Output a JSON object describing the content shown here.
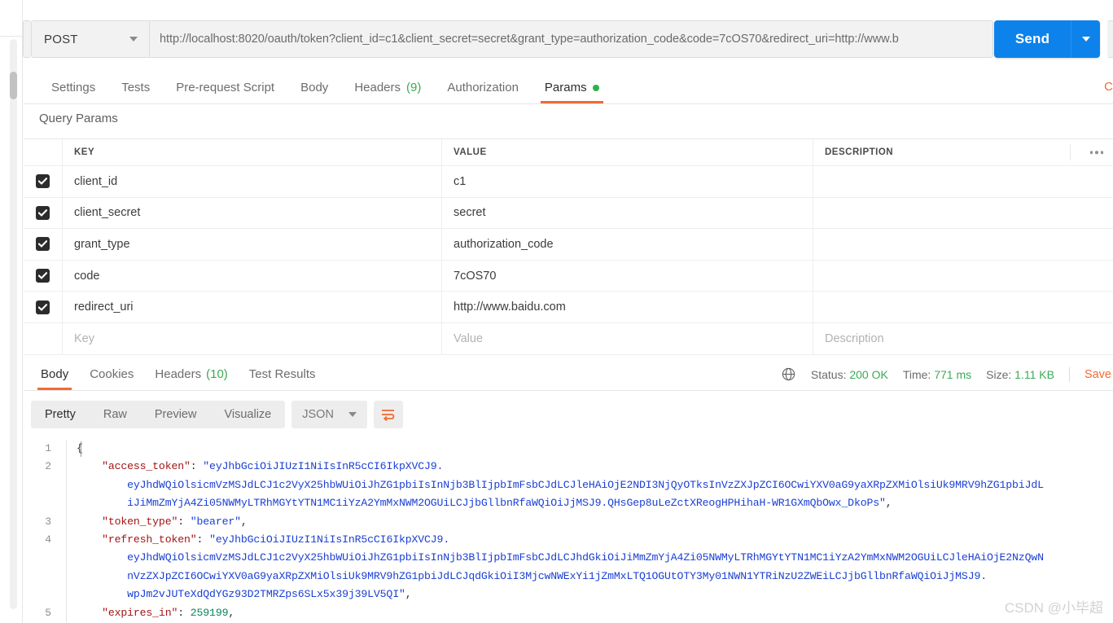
{
  "request": {
    "method": "POST",
    "url": "http://localhost:8020/oauth/token?client_id=c1&client_secret=secret&grant_type=authorization_code&code=7cOS70&redirect_uri=http://www.b",
    "send_label": "Send",
    "tabs": [
      {
        "label": "Params",
        "badge": "",
        "dot": true,
        "active": true
      },
      {
        "label": "Authorization",
        "badge": "",
        "dot": false,
        "active": false
      },
      {
        "label": "Headers",
        "badge": "(9)",
        "dot": false,
        "active": false
      },
      {
        "label": "Body",
        "badge": "",
        "dot": false,
        "active": false
      },
      {
        "label": "Pre-request Script",
        "badge": "",
        "dot": false,
        "active": false
      },
      {
        "label": "Tests",
        "badge": "",
        "dot": false,
        "active": false
      },
      {
        "label": "Settings",
        "badge": "",
        "dot": false,
        "active": false
      }
    ],
    "tabs_cut_label": "C"
  },
  "query_params": {
    "section_title": "Query Params",
    "columns": {
      "key": "KEY",
      "value": "VALUE",
      "description": "DESCRIPTION"
    },
    "rows": [
      {
        "checked": true,
        "key": "client_id",
        "value": "c1",
        "description": ""
      },
      {
        "checked": true,
        "key": "client_secret",
        "value": "secret",
        "description": ""
      },
      {
        "checked": true,
        "key": "grant_type",
        "value": "authorization_code",
        "description": ""
      },
      {
        "checked": true,
        "key": "code",
        "value": "7cOS70",
        "description": ""
      },
      {
        "checked": true,
        "key": "redirect_uri",
        "value": "http://www.baidu.com",
        "description": ""
      }
    ],
    "new_row_placeholders": {
      "key": "Key",
      "value": "Value",
      "description": "Description"
    }
  },
  "response": {
    "tabs": [
      {
        "label": "Body",
        "badge": "",
        "active": true
      },
      {
        "label": "Cookies",
        "badge": "",
        "active": false
      },
      {
        "label": "Headers",
        "badge": "(10)",
        "active": false
      },
      {
        "label": "Test Results",
        "badge": "",
        "active": false
      }
    ],
    "status_label": "Status:",
    "status_value": "200 OK",
    "time_label": "Time:",
    "time_value": "771 ms",
    "size_label": "Size:",
    "size_value": "1.11 KB",
    "save_label": "Save",
    "format_buttons": [
      {
        "label": "Pretty",
        "active": true
      },
      {
        "label": "Raw",
        "active": false
      },
      {
        "label": "Preview",
        "active": false
      },
      {
        "label": "Visualize",
        "active": false
      }
    ],
    "format_select": "JSON",
    "body_lines": [
      {
        "num": "1",
        "segments": [
          {
            "t": "{",
            "c": "p"
          }
        ]
      },
      {
        "num": "2",
        "segments": [
          {
            "t": "    ",
            "c": "p"
          },
          {
            "t": "\"access_token\"",
            "c": "k"
          },
          {
            "t": ": ",
            "c": "p"
          },
          {
            "t": "\"eyJhbGciOiJIUzI1NiIsInR5cCI6IkpXVCJ9.",
            "c": "s"
          }
        ]
      },
      {
        "num": "",
        "segments": [
          {
            "t": "        eyJhdWQiOlsicmVzMSJdLCJ1c2VyX25hbWUiOiJhZG1pbiIsInNjb3BlIjpbImFsbCJdLCJleHAiOjE2NDI3NjQyOTksInVzZXJpZCI6OCwiYXV0aG9yaXRpZXMiOlsiUk9MRV9hZG1pbiJdL",
            "c": "s"
          }
        ]
      },
      {
        "num": "",
        "segments": [
          {
            "t": "        iJiMmZmYjA4Zi05NWMyLTRhMGYtYTN1MC1iYzA2YmMxNWM2OGUiLCJjbGllbnRfaWQiOiJjMSJ9.QHsGep8uLeZctXReogHPHihaH-WR1GXmQbOwx_DkoPs\"",
            "c": "s"
          },
          {
            "t": ",",
            "c": "p"
          }
        ]
      },
      {
        "num": "3",
        "segments": [
          {
            "t": "    ",
            "c": "p"
          },
          {
            "t": "\"token_type\"",
            "c": "k"
          },
          {
            "t": ": ",
            "c": "p"
          },
          {
            "t": "\"bearer\"",
            "c": "s"
          },
          {
            "t": ",",
            "c": "p"
          }
        ]
      },
      {
        "num": "4",
        "segments": [
          {
            "t": "    ",
            "c": "p"
          },
          {
            "t": "\"refresh_token\"",
            "c": "k"
          },
          {
            "t": ": ",
            "c": "p"
          },
          {
            "t": "\"eyJhbGciOiJIUzI1NiIsInR5cCI6IkpXVCJ9.",
            "c": "s"
          }
        ]
      },
      {
        "num": "",
        "segments": [
          {
            "t": "        eyJhdWQiOlsicmVzMSJdLCJ1c2VyX25hbWUiOiJhZG1pbiIsInNjb3BlIjpbImFsbCJdLCJhdGkiOiJiMmZmYjA4Zi05NWMyLTRhMGYtYTN1MC1iYzA2YmMxNWM2OGUiLCJleHAiOjE2NzQwN",
            "c": "s"
          }
        ]
      },
      {
        "num": "",
        "segments": [
          {
            "t": "        nVzZXJpZCI6OCwiYXV0aG9yaXRpZXMiOlsiUk9MRV9hZG1pbiJdLCJqdGkiOiI3MjcwNWExYi1jZmMxLTQ1OGUtOTY3My01NWN1YTRiNzU2ZWEiLCJjbGllbnRfaWQiOiJjMSJ9.",
            "c": "s"
          }
        ]
      },
      {
        "num": "",
        "segments": [
          {
            "t": "        wpJm2vJUTeXdQdYGz93D2TMRZps6SLx5x39j39LV5QI\"",
            "c": "s"
          },
          {
            "t": ",",
            "c": "p"
          }
        ]
      },
      {
        "num": "5",
        "segments": [
          {
            "t": "    ",
            "c": "p"
          },
          {
            "t": "\"expires_in\"",
            "c": "k"
          },
          {
            "t": ": ",
            "c": "p"
          },
          {
            "t": "259199",
            "c": "n"
          },
          {
            "t": ",",
            "c": "p"
          }
        ]
      }
    ]
  },
  "watermark": "CSDN @小毕超",
  "colors": {
    "accent_orange": "#ef6c35",
    "send_blue": "#0d82ea",
    "status_green": "#3aab55"
  }
}
